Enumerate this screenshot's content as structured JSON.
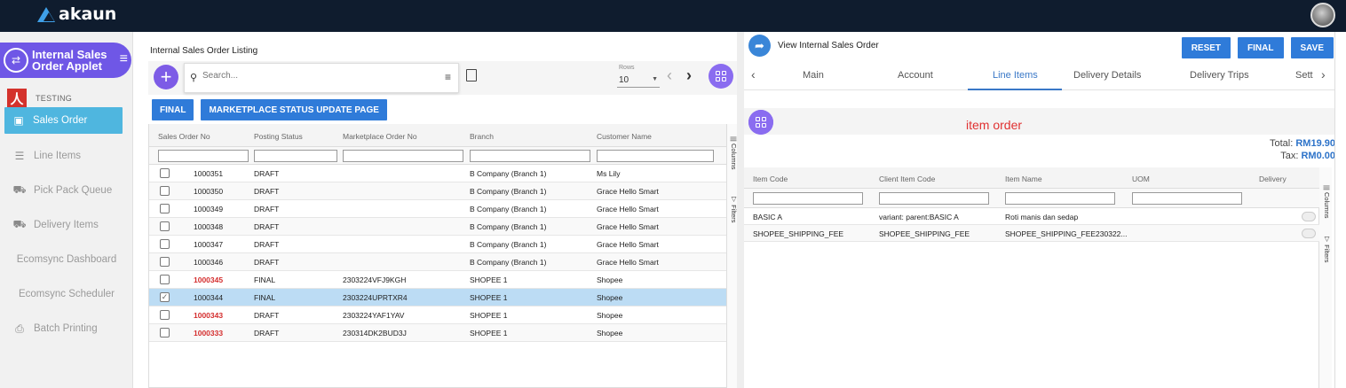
{
  "app": {
    "brand": "akaun"
  },
  "sidebar": {
    "applet_title": "Internal Sales Order Applet",
    "org_label": "TESTING",
    "items": [
      {
        "label": "Sales Order",
        "icon": "document-icon"
      },
      {
        "label": "Line Items",
        "icon": "list-icon"
      },
      {
        "label": "Pick Pack Queue",
        "icon": "truck-icon"
      },
      {
        "label": "Delivery Items",
        "icon": "truck-icon"
      },
      {
        "label": "Ecomsync Dashboard",
        "icon": ""
      },
      {
        "label": "Ecomsync Scheduler",
        "icon": ""
      },
      {
        "label": "Batch Printing",
        "icon": "printer-icon"
      }
    ]
  },
  "listing": {
    "title": "Internal Sales Order Listing",
    "search_placeholder": "Search...",
    "rows_label": "Rows",
    "rows_value": "10",
    "buttons": {
      "final": "FINAL",
      "marketplace": "MARKETPLACE STATUS UPDATE PAGE"
    },
    "columns": [
      "Sales Order No",
      "Posting Status",
      "Marketplace Order No",
      "Branch",
      "Customer Name"
    ],
    "side_tabs": {
      "columns": "Columns",
      "filters": "Filters"
    },
    "rows": [
      {
        "no": "1000351",
        "status": "DRAFT",
        "mp": "",
        "branch": "B Company (Branch 1)",
        "customer": "Ms Lily"
      },
      {
        "no": "1000350",
        "status": "DRAFT",
        "mp": "",
        "branch": "B Company (Branch 1)",
        "customer": "Grace Hello Smart"
      },
      {
        "no": "1000349",
        "status": "DRAFT",
        "mp": "",
        "branch": "B Company (Branch 1)",
        "customer": "Grace Hello Smart"
      },
      {
        "no": "1000348",
        "status": "DRAFT",
        "mp": "",
        "branch": "B Company (Branch 1)",
        "customer": "Grace Hello Smart"
      },
      {
        "no": "1000347",
        "status": "DRAFT",
        "mp": "",
        "branch": "B Company (Branch 1)",
        "customer": "Grace Hello Smart"
      },
      {
        "no": "1000346",
        "status": "DRAFT",
        "mp": "",
        "branch": "B Company (Branch 1)",
        "customer": "Grace Hello Smart"
      },
      {
        "no": "1000345",
        "status": "FINAL",
        "mp": "2303224VFJ9KGH",
        "branch": "SHOPEE 1",
        "customer": "Shopee"
      },
      {
        "no": "1000344",
        "status": "FINAL",
        "mp": "2303224UPRTXR4",
        "branch": "SHOPEE 1",
        "customer": "Shopee"
      },
      {
        "no": "1000343",
        "status": "DRAFT",
        "mp": "2303224YAF1YAV",
        "branch": "SHOPEE 1",
        "customer": "Shopee"
      },
      {
        "no": "1000333",
        "status": "DRAFT",
        "mp": "230314DK2BUD3J",
        "branch": "SHOPEE 1",
        "customer": "Shopee"
      }
    ]
  },
  "detail": {
    "title": "View Internal Sales Order",
    "buttons": {
      "reset": "RESET",
      "final": "FINAL",
      "save": "SAVE"
    },
    "tabs": [
      "Main",
      "Account",
      "Line Items",
      "Delivery Details",
      "Delivery Trips",
      "Sett"
    ],
    "active_tab": "Line Items",
    "heading": "item order",
    "total_label": "Total:",
    "total_value": "RM19.90",
    "tax_label": "Tax:",
    "tax_value": "RM0.00",
    "columns": [
      "Item Code",
      "Client Item Code",
      "Item Name",
      "UOM",
      "Delivery"
    ],
    "side_tabs": {
      "columns": "Columns",
      "filters": "Filters"
    },
    "rows": [
      {
        "code": "BASIC A",
        "client": "variant: parent:BASIC A",
        "name": "Roti manis dan sedap",
        "uom": ""
      },
      {
        "code": "SHOPEE_SHIPPING_FEE",
        "client": "SHOPEE_SHIPPING_FEE",
        "name": "SHOPEE_SHIPPING_FEE230322...",
        "uom": ""
      }
    ]
  },
  "colors": {
    "topbar": "#0f1c2e",
    "accent_purple": "#7d5ce6",
    "primary_blue": "#2f7bd9",
    "sidebar_active": "#4fb6df",
    "selected_row": "#bcdcf4",
    "red_text": "#d42e2e"
  }
}
